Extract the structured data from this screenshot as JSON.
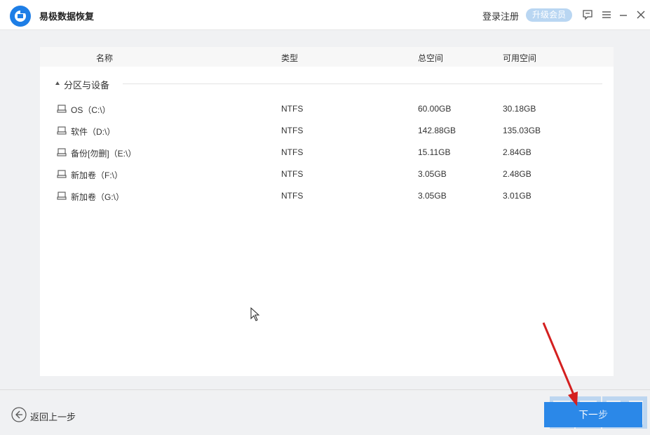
{
  "app": {
    "title": "易极数据恢复",
    "login_label": "登录注册",
    "vip_label": "升级会员",
    "brand_color": "#1e7ee6"
  },
  "table": {
    "headers": {
      "name": "名称",
      "type": "类型",
      "total": "总空间",
      "free": "可用空间"
    },
    "group_label": "分区与设备",
    "rows": [
      {
        "name": "OS（C:\\）",
        "type": "NTFS",
        "total": "60.00GB",
        "free": "30.18GB"
      },
      {
        "name": "软件（D:\\）",
        "type": "NTFS",
        "total": "142.88GB",
        "free": "135.03GB"
      },
      {
        "name": "备份[勿删]（E:\\）",
        "type": "NTFS",
        "total": "15.11GB",
        "free": "2.84GB"
      },
      {
        "name": "新加卷（F:\\）",
        "type": "NTFS",
        "total": "3.05GB",
        "free": "2.48GB"
      },
      {
        "name": "新加卷（G:\\）",
        "type": "NTFS",
        "total": "3.05GB",
        "free": "3.01GB"
      }
    ]
  },
  "footer": {
    "back_label": "返回上一步",
    "next_label": "下一步",
    "accent_color": "#2b88e8"
  },
  "icons": {
    "logo": "app-logo-icon",
    "feedback": "feedback-icon",
    "menu": "menu-icon",
    "minimize": "minimize-icon",
    "close": "close-icon",
    "drive": "hard-drive-icon",
    "back": "back-arrow-icon"
  }
}
